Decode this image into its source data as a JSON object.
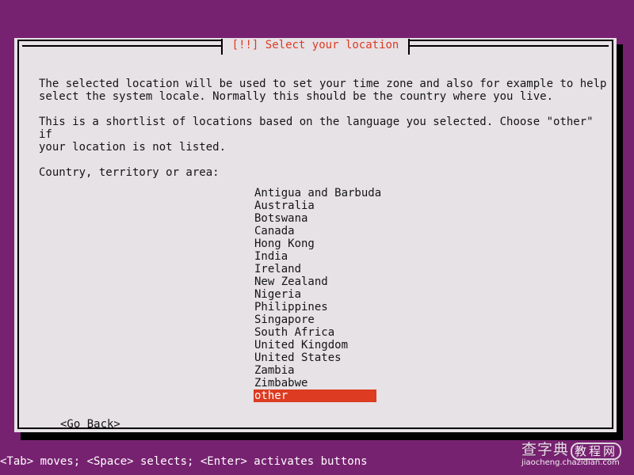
{
  "screen": {
    "background_color": "#772270",
    "dialog_background_color": "#e6e2e6",
    "accent_color": "#dd3b22",
    "text_color": "#151515"
  },
  "dialog": {
    "title": "[!!] Select your location",
    "paragraphs": [
      "The selected location will be used to set your time zone and also for example to help\nselect the system locale. Normally this should be the country where you live.",
      "This is a shortlist of locations based on the language you selected. Choose \"other\" if\nyour location is not listed."
    ],
    "list_label": "Country, territory or area:",
    "countries": [
      {
        "label": "Antigua and Barbuda",
        "selected": false
      },
      {
        "label": "Australia",
        "selected": false
      },
      {
        "label": "Botswana",
        "selected": false
      },
      {
        "label": "Canada",
        "selected": false
      },
      {
        "label": "Hong Kong",
        "selected": false
      },
      {
        "label": "India",
        "selected": false
      },
      {
        "label": "Ireland",
        "selected": false
      },
      {
        "label": "New Zealand",
        "selected": false
      },
      {
        "label": "Nigeria",
        "selected": false
      },
      {
        "label": "Philippines",
        "selected": false
      },
      {
        "label": "Singapore",
        "selected": false
      },
      {
        "label": "South Africa",
        "selected": false
      },
      {
        "label": "United Kingdom",
        "selected": false
      },
      {
        "label": "United States",
        "selected": false
      },
      {
        "label": "Zambia",
        "selected": false
      },
      {
        "label": "Zimbabwe",
        "selected": false
      },
      {
        "label": "other",
        "selected": true
      }
    ],
    "go_back_button": "<Go Back>"
  },
  "help_bar": {
    "text": "<Tab> moves; <Space> selects; <Enter> activates buttons"
  },
  "watermark": {
    "logo_primary": "查字典",
    "logo_secondary": "教程网",
    "url": "jiaocheng.chazidian.com"
  }
}
